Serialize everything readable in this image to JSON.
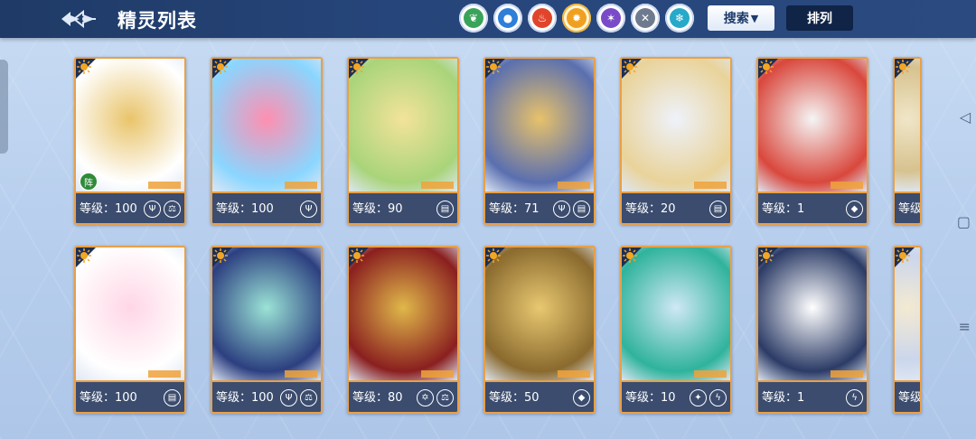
{
  "header": {
    "title": "精灵列表",
    "search_label": "搜索",
    "sort_label": "排列"
  },
  "elements": [
    {
      "name": "grass",
      "icon": "leaf-icon",
      "color": "#3aa35a"
    },
    {
      "name": "water",
      "icon": "water-drop-icon",
      "color": "#2d7fd8"
    },
    {
      "name": "fire",
      "icon": "flame-icon",
      "color": "#e0452c"
    },
    {
      "name": "light",
      "icon": "sun-icon",
      "color": "#f0a020",
      "active": true
    },
    {
      "name": "dark",
      "icon": "dark-star-icon",
      "color": "#7a4bc8"
    },
    {
      "name": "normal",
      "icon": "cross-icon",
      "color": "#6e7b8f"
    },
    {
      "name": "ice",
      "icon": "snowflake-icon",
      "color": "#27a9c9"
    }
  ],
  "sprites": [
    {
      "level": "等级：100",
      "badges": [
        "trident-icon",
        "scales-icon"
      ],
      "formation": "阵",
      "art": [
        "#e9c46a",
        "#ffffff"
      ]
    },
    {
      "level": "等级：100",
      "badges": [
        "trident-icon"
      ],
      "art": [
        "#ff8fb0",
        "#8ad6ff"
      ]
    },
    {
      "level": "等级：90",
      "badges": [
        "book-icon"
      ],
      "art": [
        "#f3e39a",
        "#a9d47a"
      ]
    },
    {
      "level": "等级：71",
      "badges": [
        "trident-icon",
        "book-icon"
      ],
      "art": [
        "#e8c26a",
        "#5a6fb0"
      ]
    },
    {
      "level": "等级：20",
      "badges": [
        "book-icon"
      ],
      "art": [
        "#eef2fb",
        "#e9d39a"
      ]
    },
    {
      "level": "等级：1",
      "badges": [
        "shield-icon"
      ],
      "art": [
        "#f5f5f5",
        "#d9473c"
      ]
    },
    {
      "level": "等级：",
      "badges": [],
      "art": [
        "#f0e6c8",
        "#d7c28f"
      ]
    },
    {
      "level": "等级：100",
      "badges": [
        "book-icon"
      ],
      "art": [
        "#ffd6e6",
        "#ffffff"
      ]
    },
    {
      "level": "等级：100",
      "badges": [
        "trident-icon",
        "scales-icon"
      ],
      "art": [
        "#9be3d6",
        "#2c3f80"
      ]
    },
    {
      "level": "等级：80",
      "badges": [
        "hexagram-icon",
        "scales-icon"
      ],
      "art": [
        "#e0b84a",
        "#8a1f1f"
      ]
    },
    {
      "level": "等级：50",
      "badges": [
        "shield-icon"
      ],
      "art": [
        "#e8c870",
        "#8a6a2e"
      ]
    },
    {
      "level": "等级：10",
      "badges": [
        "crystal-icon",
        "lightning-icon"
      ],
      "art": [
        "#cfe8f6",
        "#2fb39c"
      ]
    },
    {
      "level": "等级：1",
      "badges": [
        "lightning-icon"
      ],
      "art": [
        "#ffffff",
        "#2b3b66"
      ]
    },
    {
      "level": "等级：",
      "badges": [],
      "art": [
        "#f4ead2",
        "#cbd6ec"
      ]
    }
  ]
}
